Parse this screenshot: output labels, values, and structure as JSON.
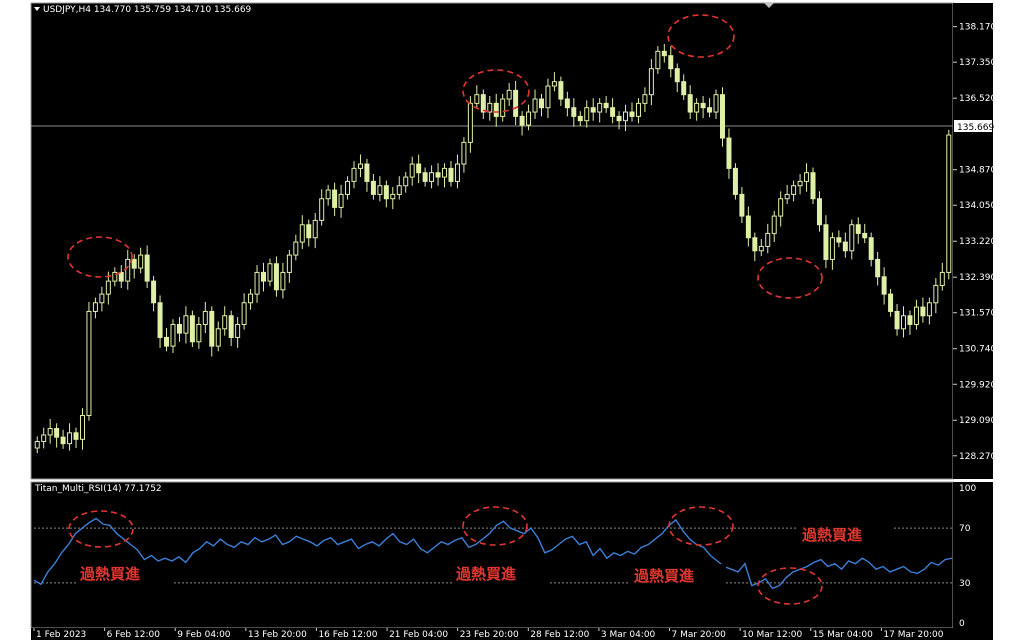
{
  "symbol_header": "USDJPY,H4  134.770 135.759 134.710 135.669",
  "price_axis": {
    "ticks": [
      "138.170",
      "137.350",
      "136.520",
      "135.669",
      "134.870",
      "134.050",
      "133.220",
      "132.390",
      "131.570",
      "130.740",
      "129.920",
      "129.090",
      "128.270"
    ],
    "current_price": "135.669",
    "range": [
      127.85,
      138.6
    ]
  },
  "indicator": {
    "header": "Titan_Multi_RSI(14) 77.1752",
    "levels": [
      "100",
      "70",
      "30",
      "0"
    ],
    "range": [
      0,
      100
    ],
    "overbought": 70,
    "oversold": 30
  },
  "time_axis": [
    "1 Feb 2023",
    "6 Feb 12:00",
    "9 Feb 04:00",
    "13 Feb 20:00",
    "16 Feb 12:00",
    "21 Feb 04:00",
    "23 Feb 20:00",
    "28 Feb 12:00",
    "3 Mar 04:00",
    "7 Mar 20:00",
    "10 Mar 12:00",
    "15 Mar 04:00",
    "17 Mar 20:00"
  ],
  "annotations": [
    "過熱買進",
    "過熱買進",
    "過熱買進",
    "過熱買進"
  ],
  "colors": {
    "background": "#000000",
    "candle_bull": "#000000",
    "candle_bear": "#ddf0a6",
    "rsi_line": "#3c7fd6",
    "annotation": "#e0362f",
    "level_line": "#808080"
  },
  "chart_data": {
    "type": "candlestick",
    "close_series": [
      128.6,
      128.75,
      128.9,
      128.7,
      128.55,
      128.8,
      128.65,
      129.2,
      131.6,
      131.8,
      132.0,
      132.3,
      132.5,
      132.3,
      132.8,
      132.6,
      132.9,
      132.3,
      131.8,
      131.0,
      130.8,
      131.3,
      131.1,
      131.5,
      130.9,
      131.3,
      131.6,
      130.8,
      131.2,
      131.5,
      131.0,
      131.3,
      131.8,
      132.0,
      132.5,
      132.3,
      132.7,
      132.1,
      132.5,
      132.9,
      133.2,
      133.6,
      133.3,
      133.7,
      134.2,
      134.4,
      134.0,
      134.3,
      134.6,
      134.9,
      135.0,
      134.6,
      134.3,
      134.5,
      134.2,
      134.3,
      134.5,
      134.7,
      135.0,
      134.8,
      134.6,
      134.8,
      134.7,
      134.9,
      134.6,
      135.0,
      135.5,
      136.4,
      136.6,
      136.2,
      136.4,
      136.1,
      136.5,
      136.7,
      136.1,
      135.9,
      136.2,
      136.5,
      136.3,
      136.8,
      136.9,
      136.5,
      136.3,
      136.1,
      136.0,
      136.3,
      136.2,
      136.4,
      136.3,
      136.1,
      136.0,
      136.2,
      136.1,
      136.4,
      136.6,
      137.2,
      137.6,
      137.5,
      137.2,
      136.9,
      136.6,
      136.2,
      136.4,
      136.3,
      136.2,
      136.6,
      135.6,
      134.9,
      134.3,
      133.8,
      133.3,
      133.0,
      133.1,
      133.4,
      133.8,
      134.2,
      134.3,
      134.5,
      134.6,
      134.8,
      134.2,
      133.6,
      132.8,
      133.3,
      133.2,
      133.0,
      133.6,
      133.4,
      133.3,
      132.8,
      132.4,
      132.0,
      131.6,
      131.2,
      131.5,
      131.3,
      131.7,
      131.5,
      131.8,
      132.2,
      132.5,
      135.669
    ],
    "rsi_series": [
      32,
      29,
      38,
      44,
      52,
      58,
      66,
      70,
      74,
      77,
      73,
      72,
      66,
      62,
      58,
      54,
      47,
      50,
      46,
      48,
      46,
      49,
      45,
      52,
      55,
      60,
      57,
      62,
      58,
      56,
      60,
      58,
      63,
      60,
      62,
      65,
      58,
      60,
      64,
      62,
      60,
      57,
      61,
      63,
      58,
      60,
      62,
      55,
      58,
      60,
      57,
      62,
      66,
      60,
      58,
      62,
      55,
      52,
      56,
      60,
      58,
      61,
      63,
      56,
      58,
      62,
      66,
      72,
      75,
      70,
      68,
      66,
      70,
      63,
      52,
      54,
      58,
      62,
      64,
      58,
      60,
      50,
      55,
      48,
      52,
      50,
      53,
      51,
      56,
      58,
      62,
      66,
      72,
      76,
      68,
      62,
      58,
      56,
      50,
      46,
      42,
      40,
      38,
      44,
      28,
      30,
      33,
      26,
      28,
      34,
      38,
      40,
      42,
      45,
      47,
      42,
      44,
      40,
      46,
      44,
      48,
      45,
      40,
      42,
      38,
      40,
      42,
      38,
      37,
      40,
      45,
      43,
      47,
      48
    ],
    "ylim": [
      127.85,
      138.6
    ]
  }
}
